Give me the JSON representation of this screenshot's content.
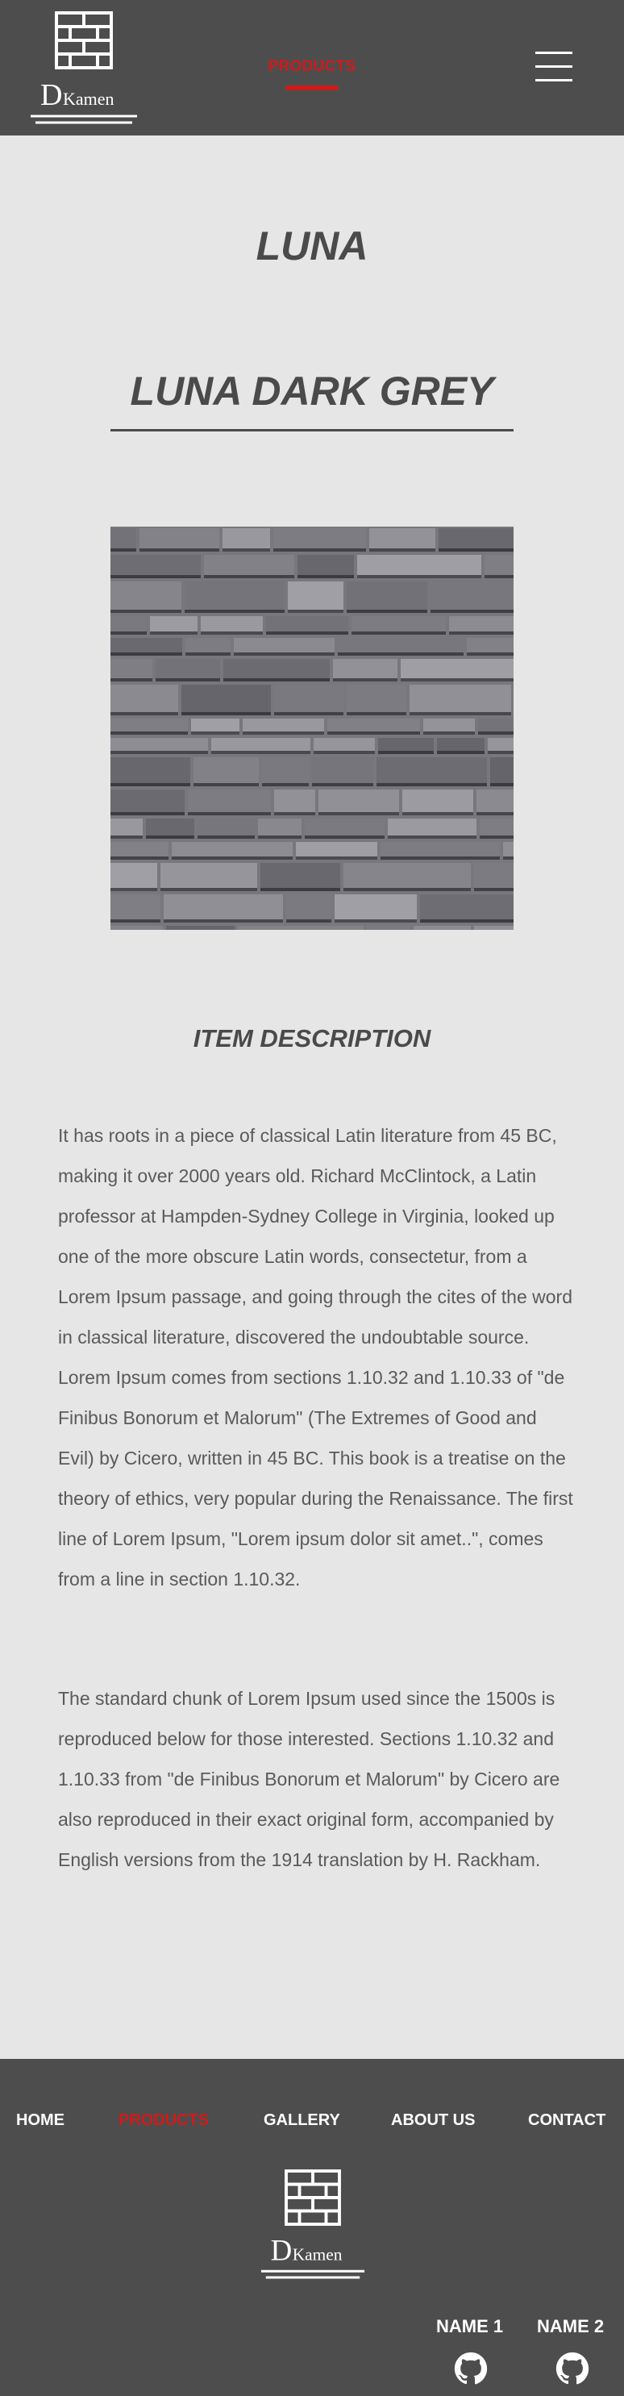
{
  "header": {
    "logo": {
      "letter": "D",
      "name": "Kamen"
    },
    "nav_active_label": "PRODUCTS",
    "menu_icon": "hamburger-menu-icon"
  },
  "main": {
    "page_title": "LUNA",
    "product_title": "LUNA DARK GREY",
    "product_image": "stacked dark grey stone wall cladding",
    "description_heading": "ITEM DESCRIPTION",
    "paragraphs": [
      "It has roots in a piece of classical Latin literature from 45 BC, making it over 2000 years old. Richard McClintock, a Latin professor at Hampden-Sydney College in Virginia, looked up one of the more obscure Latin words, consectetur, from a Lorem Ipsum passage, and going through the cites of the word in classical literature, discovered the undoubtable source. Lorem Ipsum comes from sections 1.10.32 and 1.10.33 of \"de Finibus Bonorum et Malorum\" (The Extremes of Good and Evil) by Cicero, written in 45 BC. This book is a treatise on the theory of ethics, very popular during the Renaissance. The first line of Lorem Ipsum, \"Lorem ipsum dolor sit amet..\", comes from a line in section 1.10.32.",
      "The standard chunk of Lorem Ipsum used since the 1500s is reproduced below for those interested. Sections 1.10.32 and 1.10.33 from \"de Finibus Bonorum et Malorum\" by Cicero are also reproduced in their exact original form, accompanied by English versions from the 1914 translation by H. Rackham."
    ]
  },
  "footer": {
    "nav": [
      "HOME",
      "PRODUCTS",
      "GALLERY",
      "ABOUT US",
      "CONTACT"
    ],
    "active_nav": "PRODUCTS",
    "logo": {
      "letter": "D",
      "name": "Kamen"
    },
    "authors": [
      {
        "name": "NAME 1",
        "icon": "github-icon"
      },
      {
        "name": "NAME 2",
        "icon": "github-icon"
      }
    ]
  },
  "colors": {
    "header_bg": "#4d4d4d",
    "page_bg": "#e6e6e6",
    "accent": "#d11a1a",
    "text": "#4a4a4a"
  }
}
